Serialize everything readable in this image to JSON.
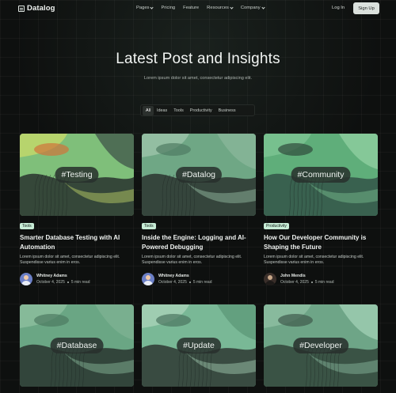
{
  "brand": {
    "name": "Datalog"
  },
  "nav": {
    "links": [
      {
        "label": "Pages",
        "dropdown": true
      },
      {
        "label": "Pricing",
        "dropdown": false
      },
      {
        "label": "Feature",
        "dropdown": false
      },
      {
        "label": "Resources",
        "dropdown": true
      },
      {
        "label": "Company",
        "dropdown": true
      }
    ],
    "login": "Log In",
    "signup": "Sign Up"
  },
  "hero": {
    "title": "Latest Post and Insights",
    "subtitle": "Lorem ipsum dolor sit amet, consectetur adipiscing elit."
  },
  "filters": {
    "items": [
      "All",
      "Ideas",
      "Tools",
      "Productivity",
      "Business"
    ],
    "active": "All"
  },
  "posts": [
    {
      "hashtag": "#Testing",
      "tag": "Tools",
      "title": "Smarter Database Testing with AI Automation",
      "excerpt": "Lorem ipsum dolor sit amet, consectetur adipiscing elit. Suspendisse varius enim in eros.",
      "author": "Whitney Adams",
      "date": "October 4, 2025",
      "read": "5 min read",
      "palette": [
        "#7fbf7a",
        "#2e3a32",
        "#c6d96a",
        "#d0733a",
        "#46604f"
      ]
    },
    {
      "hashtag": "#Datalog",
      "tag": "Tools",
      "title": "Inside the Engine: Logging and AI-Powered Debugging",
      "excerpt": "Lorem ipsum dolor sit amet, consectetur adipiscing elit. Suspendisse varius enim in eros.",
      "author": "Whitney Adams",
      "date": "October 4, 2025",
      "read": "5 min read",
      "palette": [
        "#6fa785",
        "#2f3b34",
        "#9cc4a9",
        "#4f7a62",
        "#87b598"
      ]
    },
    {
      "hashtag": "#Community",
      "tag": "Productivity",
      "title": "How Our Developer Community is Shaping the Future",
      "excerpt": "Lorem ipsum dolor sit amet, consectetur adipiscing elit. Suspendisse varius enim in eros.",
      "author": "John Mendis",
      "date": "October 4, 2025",
      "read": "5 min read",
      "palette": [
        "#5fae7a",
        "#35594a",
        "#7dc493",
        "#2f4a3c",
        "#8ccc9e"
      ]
    },
    {
      "hashtag": "#Database",
      "tag": "",
      "title": "",
      "excerpt": "",
      "author": "",
      "date": "",
      "read": "",
      "palette": [
        "#6aa684",
        "#2c3b33",
        "#8dbf9f",
        "#4d7a61",
        "#7bb091"
      ]
    },
    {
      "hashtag": "#Update",
      "tag": "",
      "title": "",
      "excerpt": "",
      "author": "",
      "date": "",
      "read": "",
      "palette": [
        "#79b896",
        "#323f37",
        "#a9d2b8",
        "#4c7560",
        "#5f9b7b"
      ]
    },
    {
      "hashtag": "#Developer",
      "tag": "",
      "title": "",
      "excerpt": "",
      "author": "",
      "date": "",
      "read": "",
      "palette": [
        "#6ea587",
        "#344a3e",
        "#8fbfa2",
        "#3e5a4b",
        "#9ccbb0"
      ]
    }
  ]
}
